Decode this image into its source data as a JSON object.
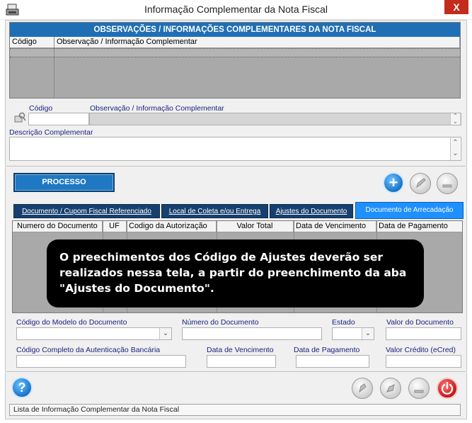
{
  "window": {
    "title": "Informação Complementar da Nota Fiscal",
    "close_symbol": "X"
  },
  "obs_grid": {
    "header": "OBSERVAÇÕES / INFORMAÇÕES COMPLEMENTARES DA NOTA FISCAL",
    "columns": [
      "Código",
      "Observação / Informação Complementar"
    ]
  },
  "form_obs": {
    "codigo_label": "Código",
    "observacao_label": "Observação / Informação Complementar",
    "descricao_label": "Descrição Complementar",
    "codigo_value": "",
    "observacao_value": "",
    "descricao_value": ""
  },
  "buttons": {
    "processo": "PROCESSO",
    "add_symbol": "+",
    "help_symbol": "?"
  },
  "tabs": [
    "Documento / Cupom Fiscal Referenciado",
    "Local de Coleta e/ou Entrega",
    "Ajustes do Documento",
    "Documento de Arrecadação"
  ],
  "doc_grid": {
    "columns": [
      "Numero do Documento",
      "UF",
      "Codigo da Autorização",
      "Valor Total",
      "Data de Vencimento",
      "Data de Pagamento"
    ]
  },
  "callout": {
    "text": "O preechimentos dos Código de Ajustes deverão ser realizados nessa tela, a partir do preenchimento da aba \"Ajustes do Documento\"."
  },
  "doc_form": {
    "modelo_label": "Código do Modelo do Documento",
    "numero_label": "Número do Documento",
    "estado_label": "Estado",
    "valor_label": "Valor do Documento",
    "autenticacao_label": "Código Completo da Autenticação Bancária",
    "vencimento_label": "Data de Vencimento",
    "pagamento_label": "Data de Pagamento",
    "credito_label": "Valor Crédito (eCred)"
  },
  "status": {
    "text": "Lista de Informação Complementar da Nota Fiscal"
  },
  "colors": {
    "accent": "#1f6fb5",
    "tab_dark": "#16406f",
    "tab_active": "#1e90ff",
    "close": "#c42b1c",
    "power": "#d32020"
  }
}
